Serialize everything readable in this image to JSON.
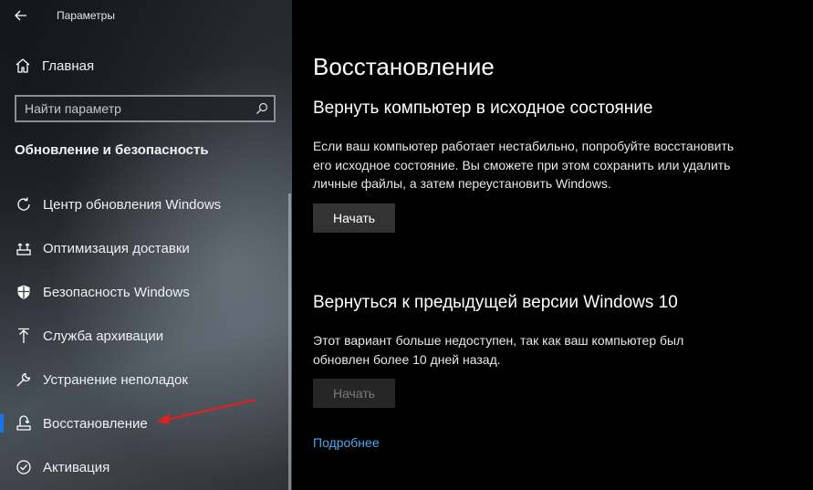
{
  "window": {
    "title": "Параметры"
  },
  "sidebar": {
    "home_label": "Главная",
    "search": {
      "placeholder": "Найти параметр",
      "value": ""
    },
    "section_title": "Обновление и безопасность",
    "items": [
      {
        "label": "Центр обновления Windows",
        "icon": "sync-icon",
        "active": false
      },
      {
        "label": "Оптимизация доставки",
        "icon": "delivery-optimization-icon",
        "active": false
      },
      {
        "label": "Безопасность Windows",
        "icon": "shield-icon",
        "active": false
      },
      {
        "label": "Служба архивации",
        "icon": "backup-arrow-icon",
        "active": false
      },
      {
        "label": "Устранение неполадок",
        "icon": "wrench-icon",
        "active": false
      },
      {
        "label": "Восстановление",
        "icon": "recovery-icon",
        "active": true
      },
      {
        "label": "Активация",
        "icon": "check-circle-icon",
        "active": false
      }
    ]
  },
  "main": {
    "page_title": "Восстановление",
    "reset": {
      "heading": "Вернуть компьютер в исходное состояние",
      "description": "Если ваш компьютер работает нестабильно, попробуйте восстановить его исходное состояние. Вы сможете при этом сохранить или удалить личные файлы, а затем переустановить Windows.",
      "button_label": "Начать",
      "button_enabled": true
    },
    "go_back": {
      "heading": "Вернуться к предыдущей версии Windows 10",
      "description": "Этот вариант больше недоступен, так как ваш компьютер был обновлен более 10 дней назад.",
      "button_label": "Начать",
      "button_enabled": false
    },
    "more_link": "Подробнее"
  },
  "colors": {
    "accent": "#1a73e8",
    "link": "#4aa8ee",
    "annotation_arrow": "#e02020"
  }
}
